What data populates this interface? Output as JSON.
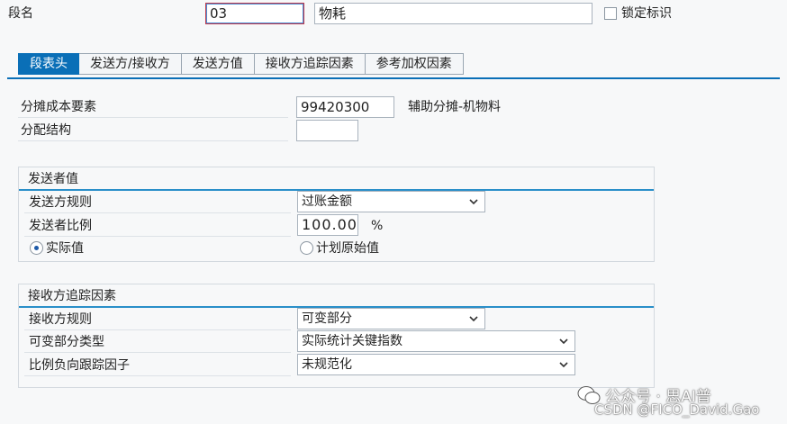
{
  "header": {
    "segment_label": "段名",
    "segment_value": "03",
    "segment_desc": "物耗",
    "lock_label": "锁定标识"
  },
  "tabs": [
    {
      "label": "段表头",
      "active": true
    },
    {
      "label": "发送方/接收方",
      "active": false
    },
    {
      "label": "发送方值",
      "active": false
    },
    {
      "label": "接收方追踪因素",
      "active": false
    },
    {
      "label": "参考加权因素",
      "active": false
    }
  ],
  "main": {
    "cost_element_label": "分摊成本要素",
    "cost_element_value": "99420300",
    "cost_element_desc": "辅助分摊-机物料",
    "alloc_structure_label": "分配结构",
    "alloc_structure_value": ""
  },
  "sender_group": {
    "title": "发送者值",
    "rule_label": "发送方规则",
    "rule_value": "过账金额",
    "ratio_label": "发送者比例",
    "ratio_value": "100.00",
    "ratio_unit": "%",
    "radio_actual": "实际值",
    "radio_plan": "计划原始值",
    "selected": "actual"
  },
  "receiver_group": {
    "title": "接收方追踪因素",
    "rule_label": "接收方规则",
    "rule_value": "可变部分",
    "var_type_label": "可变部分类型",
    "var_type_value": "实际统计关键指数",
    "neg_factor_label": "比例负向跟踪因子",
    "neg_factor_value": "未规范化"
  },
  "watermark": {
    "line1": "公众号 · 思AI普",
    "line2": "CSDN @FICO_David.Gao"
  },
  "colors": {
    "accent": "#0a6fb7",
    "group_rule": "#2a8fc9",
    "focus_border": "#c0384a"
  }
}
